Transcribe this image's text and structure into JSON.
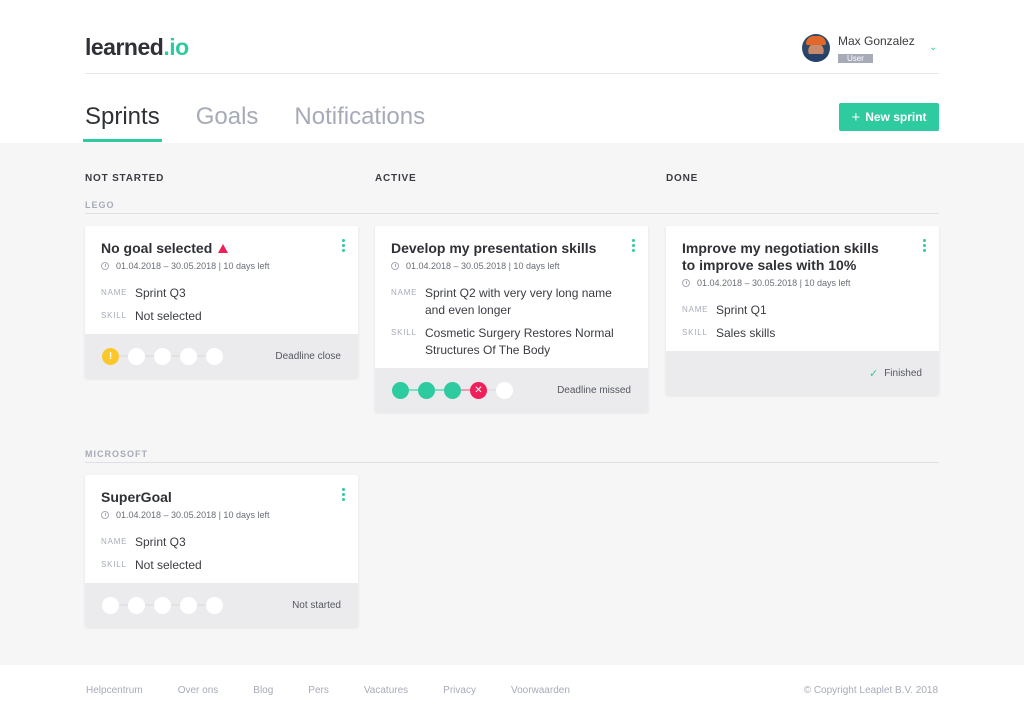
{
  "app": {
    "logo_main": "learned",
    "logo_accent": ".io"
  },
  "user": {
    "name": "Max Gonzalez",
    "role": "User",
    "chevron": "⌄"
  },
  "tabs": [
    {
      "label": "Sprints",
      "active": true
    },
    {
      "label": "Goals",
      "active": false
    },
    {
      "label": "Notifications",
      "active": false
    }
  ],
  "new_sprint_button": {
    "icon": "+",
    "label": "New sprint"
  },
  "columns": [
    "NOT STARTED",
    "ACTIVE",
    "DONE"
  ],
  "groups": [
    {
      "label": "LEGO",
      "cards": [
        {
          "column": "NOT STARTED",
          "title": "No goal selected",
          "warning": true,
          "dates": "01.04.2018 – 30.05.2018 | 10 days left",
          "name_label": "NAME",
          "name": "Sprint Q3",
          "skill_label": "SKILL",
          "skill": "Not selected",
          "steps": [
            "warning",
            "empty",
            "empty",
            "empty",
            "empty"
          ],
          "status": "Deadline close"
        },
        {
          "column": "ACTIVE",
          "title": "Develop my presentation skills",
          "warning": false,
          "dates": "01.04.2018 – 30.05.2018 | 10 days left",
          "name_label": "NAME",
          "name": "Sprint Q2 with very very long name and even longer",
          "skill_label": "SKILL",
          "skill": "Cosmetic Surgery Restores Normal Structures Of The Body",
          "steps": [
            "done",
            "done",
            "done",
            "missed",
            "empty"
          ],
          "status": "Deadline missed"
        },
        {
          "column": "DONE",
          "title": "Improve my negotiation skills to improve sales with 10%",
          "warning": false,
          "dates": "01.04.2018 – 30.05.2018 | 10 days left",
          "name_label": "NAME",
          "name": "Sprint Q1",
          "skill_label": "SKILL",
          "skill": "Sales skills",
          "steps": [],
          "status": "Finished"
        }
      ]
    },
    {
      "label": "MICROSOFT",
      "cards": [
        {
          "column": "NOT STARTED",
          "title": "SuperGoal",
          "warning": false,
          "dates": "01.04.2018 – 30.05.2018 | 10 days left",
          "name_label": "NAME",
          "name": "Sprint Q3",
          "skill_label": "SKILL",
          "skill": "Not selected",
          "steps": [
            "empty",
            "empty",
            "empty",
            "empty",
            "empty"
          ],
          "status": "Not started"
        }
      ]
    }
  ],
  "icons": {
    "step_warning": "!",
    "step_missed": "✕",
    "check": "✓"
  },
  "footer": {
    "links": [
      "Helpcentrum",
      "Over ons",
      "Blog",
      "Pers",
      "Vacatures",
      "Privacy",
      "Voorwaarden"
    ],
    "copyright": "© Copyright Leaplet B.V. 2018"
  },
  "colors": {
    "accent": "#2ecaa0",
    "danger": "#ef1f5a",
    "warning": "#fbc82b"
  }
}
